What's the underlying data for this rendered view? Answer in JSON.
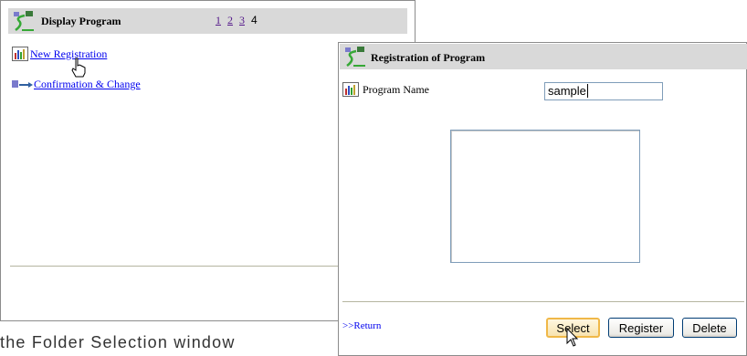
{
  "back_panel": {
    "title": "Display Program",
    "pages": [
      "1",
      "2",
      "3"
    ],
    "current_page": "4",
    "links": [
      {
        "label": "New Registration",
        "icon": "chart-icon"
      },
      {
        "label": "Confirmation & Change",
        "icon": "arrow-icon"
      }
    ]
  },
  "front_panel": {
    "title": "Registration of Program",
    "field_label": "Program Name",
    "field_value": "sample",
    "return_label": ">>Return",
    "buttons": {
      "select": "Select",
      "register": "Register",
      "delete": "Delete"
    }
  },
  "caption": "the Folder Selection window"
}
